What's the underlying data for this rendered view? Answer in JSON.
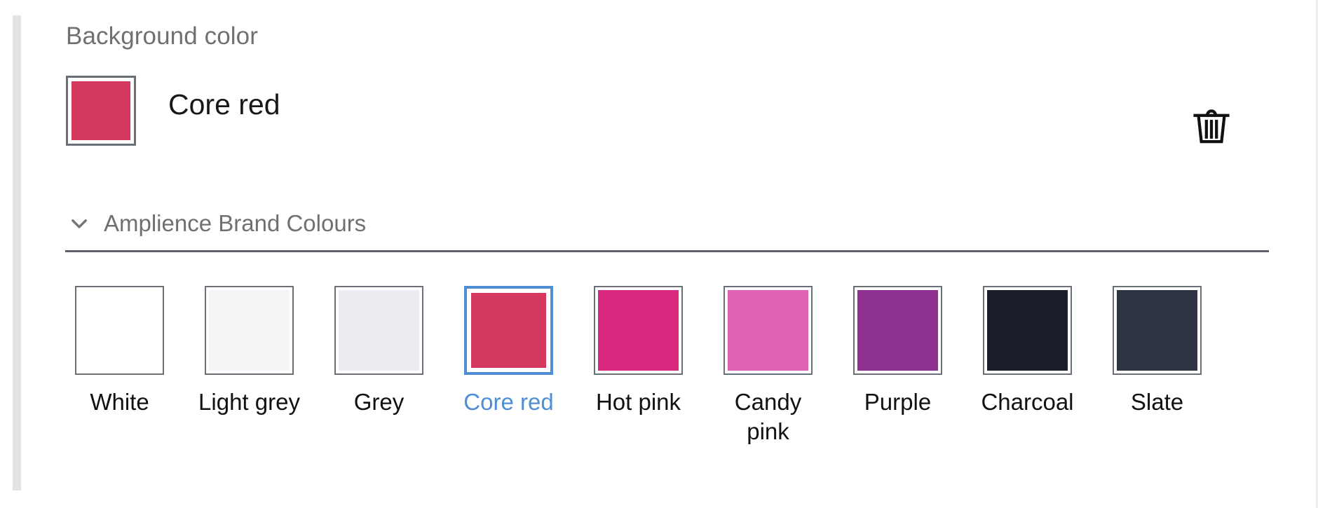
{
  "field": {
    "label": "Background color",
    "selected_color_name": "Core red",
    "selected_color_hex": "#d4385f",
    "delete_icon": "trash-icon"
  },
  "group": {
    "title": "Amplience Brand Colours",
    "expanded": true,
    "chevron_icon": "chevron-down-icon"
  },
  "palette": {
    "selected_index": 3,
    "selection_color": "#4e8ed4",
    "swatch_border_color": "#6b6f76",
    "swatches": [
      {
        "label": "White",
        "hex": "#ffffff"
      },
      {
        "label": "Light grey",
        "hex": "#f5f5f7"
      },
      {
        "label": "Grey",
        "hex": "#ececf2"
      },
      {
        "label": "Core red",
        "hex": "#d4385f"
      },
      {
        "label": "Hot pink",
        "hex": "#d92880"
      },
      {
        "label": "Candy pink",
        "hex": "#df62b4"
      },
      {
        "label": "Purple",
        "hex": "#8e3190"
      },
      {
        "label": "Charcoal",
        "hex": "#1b1f2a"
      },
      {
        "label": "Slate",
        "hex": "#2e3441"
      }
    ]
  }
}
